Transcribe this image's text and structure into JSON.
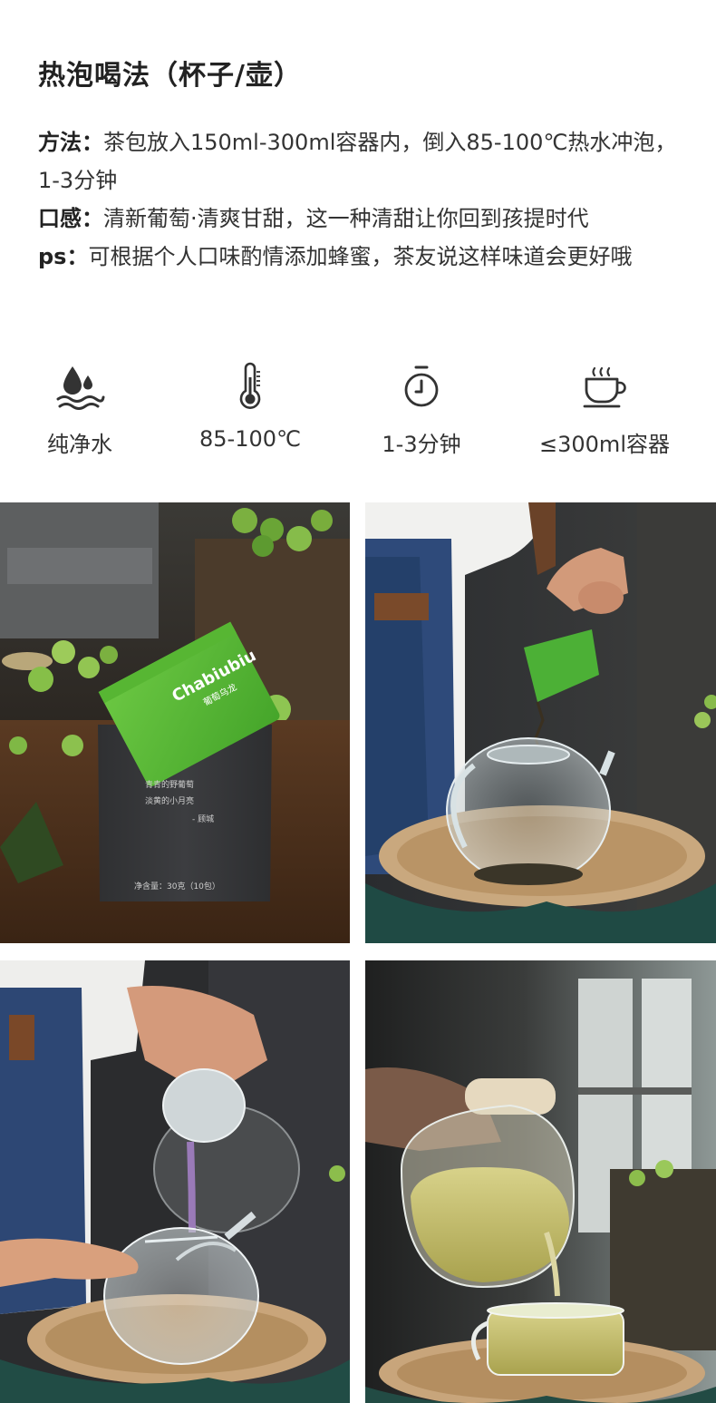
{
  "title": "热泡喝法（杯子/壶）",
  "method": {
    "label": "方法：",
    "text": "茶包放入150ml-300ml容器内，倒入85-100℃热水冲泡，1-3分钟"
  },
  "taste": {
    "label": "口感：",
    "text": "清新葡萄·清爽甘甜，这一种清甜让你回到孩提时代"
  },
  "ps": {
    "label": "ps：",
    "text": "可根据个人口味酌情添加蜂蜜，茶友说这样味道会更好哦"
  },
  "icons": [
    {
      "icon": "water-drop-icon",
      "label": "纯净水"
    },
    {
      "icon": "thermometer-icon",
      "label": "85-100℃"
    },
    {
      "icon": "stopwatch-icon",
      "label": "1-3分钟"
    },
    {
      "icon": "steaming-cup-icon",
      "label": "≤300ml容器"
    }
  ],
  "photos": {
    "package_brand": "Chabiubiu",
    "package_sub": "葡萄乌龙",
    "box_line1": "青青的野葡萄",
    "box_line2": "淡黄的小月亮",
    "box_line3": "- 顾城",
    "box_net": "净含量：30克（10包）"
  },
  "colors": {
    "text": "#333333",
    "heading": "#222222",
    "package_green": "#5fbf3a",
    "box_dark": "#3a3b3d"
  }
}
